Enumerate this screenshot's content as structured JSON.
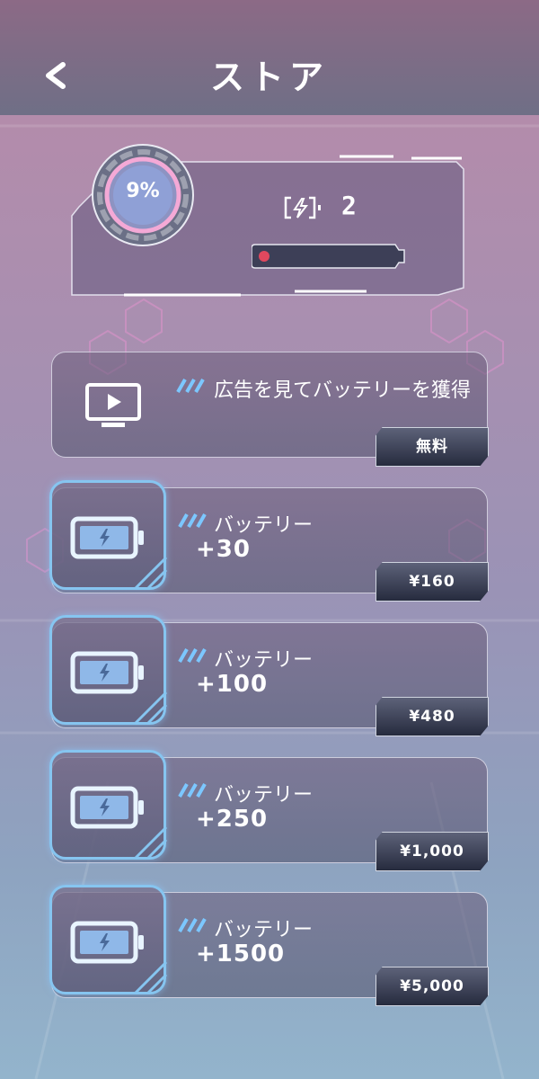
{
  "header": {
    "title": "ストア",
    "back_icon": "chevron-left-icon"
  },
  "status": {
    "percent_text": "9%",
    "percent_value": 9,
    "battery_count": "2",
    "energy_fill": 0.08,
    "colors": {
      "ring": "#f4a9d6",
      "bar_fill": "#e0485e"
    }
  },
  "ad_offer": {
    "label": "広告を見てバッテリーを獲得",
    "price": "無料",
    "icon": "play-screen-icon"
  },
  "offers": [
    {
      "label": "バッテリー",
      "amount": "+30",
      "price": "¥160"
    },
    {
      "label": "バッテリー",
      "amount": "+100",
      "price": "¥480"
    },
    {
      "label": "バッテリー",
      "amount": "+250",
      "price": "¥1,000"
    },
    {
      "label": "バッテリー",
      "amount": "+1500",
      "price": "¥5,000"
    }
  ],
  "colors": {
    "accent": "#86c5f0",
    "header": "#6f6f86"
  }
}
